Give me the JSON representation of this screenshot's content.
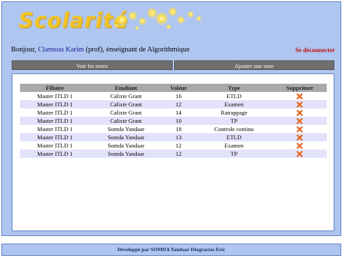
{
  "header": {
    "logo": "Scolarité"
  },
  "greeting": {
    "prefix": "Bonjour, ",
    "user": "Clamsou Karim",
    "suffix": " (prof), énseignant de Algorithmique"
  },
  "logout_label": "Se déconnecter",
  "nav": {
    "view_notes": "Voir les notes",
    "add_note": "Ajouter une note"
  },
  "table": {
    "headers": [
      "Filiaire",
      "Etudiant",
      "Valeur",
      "Type",
      "Supprimer"
    ],
    "rows": [
      [
        "Master ITLD 1",
        "Calixte Grant",
        "16",
        "ETLD"
      ],
      [
        "Master ITLD 1",
        "Calixte Grant",
        "12",
        "Examen"
      ],
      [
        "Master ITLD 1",
        "Calixte Grant",
        "14",
        "Ratrappage"
      ],
      [
        "Master ITLD 1",
        "Calixte Grant",
        "10",
        "TP"
      ],
      [
        "Master ITLD 1",
        "Somda Yandaar",
        "18",
        "Controle continu"
      ],
      [
        "Master ITLD 1",
        "Somda Yandaar",
        "13",
        "ETLD"
      ],
      [
        "Master ITLD 1",
        "Somda Yandaar",
        "12",
        "Examen"
      ],
      [
        "Master ITLD 1",
        "Somda Yandaar",
        "12",
        "TP"
      ]
    ],
    "delete_icon": "delete-x-icon"
  },
  "footer": "Développé par SOMDA Yandaar Désgracias Eric",
  "colors": {
    "frame_bg": "#afc6f0",
    "logo": "#f1c326",
    "logout": "#c01010",
    "nav_bg": "#6e6e6e",
    "table_header": "#a9a9a9",
    "row_alt": "#e2e2fa",
    "delete_icon": "#e8641c"
  }
}
